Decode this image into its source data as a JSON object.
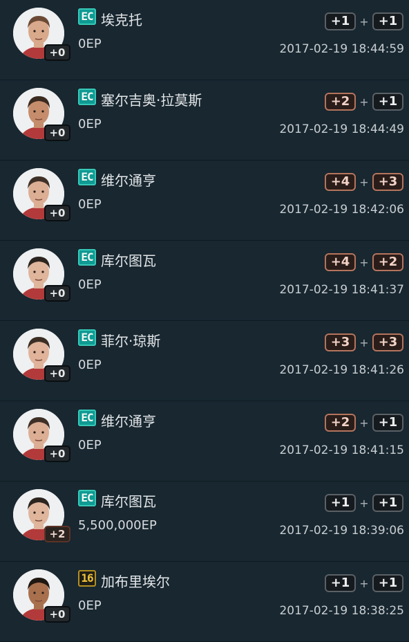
{
  "rows": [
    {
      "name": "埃克托",
      "ep": "0EP",
      "date": "2017-02-19 18:44:59",
      "tag": "EC",
      "level": "+0",
      "level_up": false,
      "left": "+1",
      "left_hl": false,
      "right": "+1",
      "right_hl": false,
      "skin": "#d9a98b",
      "hair": "#6b4a35"
    },
    {
      "name": "塞尔吉奥·拉莫斯",
      "ep": "0EP",
      "date": "2017-02-19 18:44:49",
      "tag": "EC",
      "level": "+0",
      "level_up": false,
      "left": "+2",
      "left_hl": true,
      "right": "+1",
      "right_hl": false,
      "skin": "#c68d6c",
      "hair": "#3a2a20"
    },
    {
      "name": "维尔通亨",
      "ep": "0EP",
      "date": "2017-02-19 18:42:06",
      "tag": "EC",
      "level": "+0",
      "level_up": false,
      "left": "+4",
      "left_hl": true,
      "right": "+3",
      "right_hl": true,
      "skin": "#dcae94",
      "hair": "#3f3027"
    },
    {
      "name": "库尔图瓦",
      "ep": "0EP",
      "date": "2017-02-19 18:41:37",
      "tag": "EC",
      "level": "+0",
      "level_up": false,
      "left": "+4",
      "left_hl": true,
      "right": "+2",
      "right_hl": true,
      "skin": "#dfb59c",
      "hair": "#2c241f"
    },
    {
      "name": "菲尔·琼斯",
      "ep": "0EP",
      "date": "2017-02-19 18:41:26",
      "tag": "EC",
      "level": "+0",
      "level_up": false,
      "left": "+3",
      "left_hl": true,
      "right": "+3",
      "right_hl": true,
      "skin": "#e0b39a",
      "hair": "#3c2d24"
    },
    {
      "name": "维尔通亨",
      "ep": "0EP",
      "date": "2017-02-19 18:41:15",
      "tag": "EC",
      "level": "+0",
      "level_up": false,
      "left": "+2",
      "left_hl": true,
      "right": "+1",
      "right_hl": false,
      "skin": "#dcae94",
      "hair": "#3f3027"
    },
    {
      "name": "库尔图瓦",
      "ep": "5,500,000EP",
      "date": "2017-02-19 18:39:06",
      "tag": "EC",
      "level": "+2",
      "level_up": true,
      "left": "+1",
      "left_hl": false,
      "right": "+1",
      "right_hl": false,
      "skin": "#dfb59c",
      "hair": "#2c241f"
    },
    {
      "name": "加布里埃尔",
      "ep": "0EP",
      "date": "2017-02-19 18:38:25",
      "tag": "16",
      "level": "+0",
      "level_up": false,
      "left": "+1",
      "left_hl": false,
      "right": "+1",
      "right_hl": false,
      "skin": "#a9704e",
      "hair": "#1f1712"
    }
  ],
  "separator": "+"
}
